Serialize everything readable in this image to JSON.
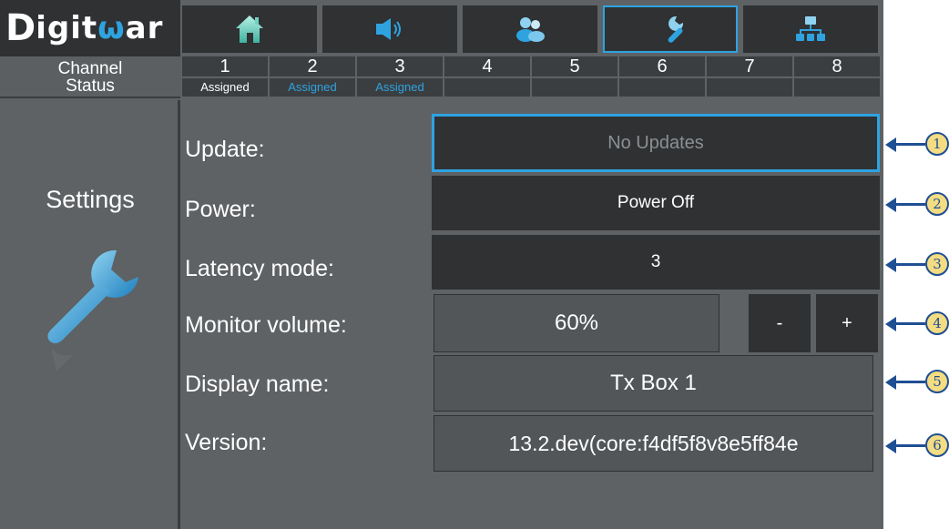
{
  "brand": {
    "logo_d": "D",
    "logo_text_1": "igit",
    "logo_text_o": "ω",
    "logo_text_2": "ar"
  },
  "channel_status": {
    "label_line1": "Channel",
    "label_line2": "Status"
  },
  "nav": [
    {
      "icon": "home-icon"
    },
    {
      "icon": "speaker-icon"
    },
    {
      "icon": "users-icon"
    },
    {
      "icon": "wrench-icon",
      "active": true
    },
    {
      "icon": "network-icon"
    }
  ],
  "channels": [
    {
      "num": "1",
      "status": "Assigned",
      "color": "#ffffff"
    },
    {
      "num": "2",
      "status": "Assigned",
      "color": "#2ea3e0"
    },
    {
      "num": "3",
      "status": "Assigned",
      "color": "#2ea3e0"
    },
    {
      "num": "4",
      "status": ""
    },
    {
      "num": "5",
      "status": ""
    },
    {
      "num": "6",
      "status": ""
    },
    {
      "num": "7",
      "status": ""
    },
    {
      "num": "8",
      "status": ""
    }
  ],
  "side": {
    "title": "Settings",
    "icon": "wrench-icon"
  },
  "settings": {
    "update": {
      "label": "Update:",
      "value": "No Updates"
    },
    "power": {
      "label": "Power:",
      "value": "Power Off"
    },
    "latency": {
      "label": "Latency mode:",
      "value": "3"
    },
    "monitor": {
      "label": "Monitor volume:",
      "value": "60%",
      "minus": "-",
      "plus": "+"
    },
    "display_name": {
      "label": "Display name:",
      "value": "Tx Box 1"
    },
    "version": {
      "label": "Version:",
      "value": "13.2.dev(core:f4df5f8v8e5ff84e"
    }
  },
  "callouts": [
    "1",
    "2",
    "3",
    "4",
    "5",
    "6"
  ],
  "colors": {
    "accent": "#2ea3e0",
    "panel": "#2f3133",
    "background": "#5e6265",
    "callout_fill": "#f4dc82",
    "callout_stroke": "#1f4f93"
  }
}
